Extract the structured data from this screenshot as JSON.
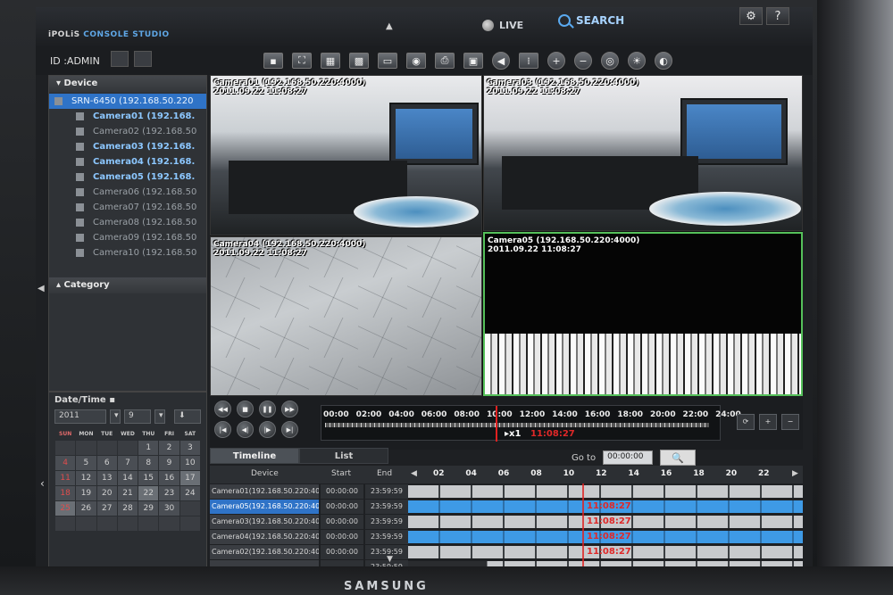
{
  "app": {
    "title_prefix": "iPOLiS",
    "title_accent": "CONSOLE STUDIO"
  },
  "topbar": {
    "live_label": "LIVE",
    "search_label": "SEARCH"
  },
  "user": {
    "id_label": "ID :ADMIN"
  },
  "device_panel": {
    "header": "Device",
    "items": [
      {
        "label": "SRN-6450 (192.168.50.220",
        "style": "selected"
      },
      {
        "label": "Camera01 (192.168.",
        "style": "bold"
      },
      {
        "label": "Camera02 (192.168.50",
        "style": "normal"
      },
      {
        "label": "Camera03 (192.168.",
        "style": "bold"
      },
      {
        "label": "Camera04 (192.168.",
        "style": "bold"
      },
      {
        "label": "Camera05 (192.168.",
        "style": "bold"
      },
      {
        "label": "Camera06 (192.168.50",
        "style": "normal"
      },
      {
        "label": "Camera07 (192.168.50",
        "style": "normal"
      },
      {
        "label": "Camera08 (192.168.50",
        "style": "normal"
      },
      {
        "label": "Camera09 (192.168.50",
        "style": "normal"
      },
      {
        "label": "Camera10 (192.168.50",
        "style": "normal"
      }
    ],
    "category_header": "Category"
  },
  "video": {
    "tiles": [
      {
        "title": "Camera01 (192.168.50.220:4000)",
        "date": "2011.09.22 11:08:27"
      },
      {
        "title": "Camera03 (192.168.50.220:4000)",
        "date": "2011.09.22 11:08:27"
      },
      {
        "title": "Camera04 (192.168.50.220:4000)",
        "date": "2011.09.22 11:08:27"
      },
      {
        "title": "Camera05 (192.168.50.220:4000)",
        "date": "2011.09.22 11:08:27"
      }
    ]
  },
  "datetime": {
    "title": "Date/Time",
    "year": "2011",
    "month": "9",
    "weekdays": [
      "SUN",
      "MON",
      "TUE",
      "WED",
      "THU",
      "FRI",
      "SAT"
    ],
    "days": [
      [
        "",
        "",
        "",
        "",
        "1",
        "2",
        "3"
      ],
      [
        "4",
        "5",
        "6",
        "7",
        "8",
        "9",
        "10"
      ],
      [
        "11",
        "12",
        "13",
        "14",
        "15",
        "16",
        "17"
      ],
      [
        "18",
        "19",
        "20",
        "21",
        "22",
        "23",
        "24"
      ],
      [
        "25",
        "26",
        "27",
        "28",
        "29",
        "30",
        ""
      ],
      [
        "",
        "",
        "",
        "",
        "",
        "",
        ""
      ]
    ]
  },
  "playback": {
    "ruler_labels": [
      "00:00",
      "02:00",
      "04:00",
      "06:00",
      "08:00",
      "10:00",
      "12:00",
      "14:00",
      "16:00",
      "18:00",
      "20:00",
      "22:00",
      "24:00"
    ],
    "speed": "▸x1",
    "time": "11:08:27"
  },
  "timeline": {
    "tabs": [
      "Timeline",
      "List"
    ],
    "goto_label": "Go to",
    "goto_value": "00:00:00",
    "columns": {
      "device": "Device",
      "start": "Start",
      "end": "End"
    },
    "hours": [
      "02",
      "04",
      "06",
      "08",
      "10",
      "12",
      "14",
      "16",
      "18",
      "20",
      "22"
    ],
    "rows": [
      {
        "device": "Camera01(192.168.50.220:40",
        "start": "00:00:00",
        "end": "23:59:59",
        "mark": ""
      },
      {
        "device": "Camera05(192.168.50.220:40",
        "start": "00:00:00",
        "end": "23:59:59",
        "mark": "11:08:27"
      },
      {
        "device": "Camera03(192.168.50.220:40",
        "start": "00:00:00",
        "end": "23:59:59",
        "mark": "11:08:27"
      },
      {
        "device": "Camera04(192.168.50.220:40",
        "start": "00:00:00",
        "end": "23:59:59",
        "mark": "11:08:27"
      },
      {
        "device": "Camera02(192.168.50.220:40",
        "start": "00:00:00",
        "end": "23:59:59",
        "mark": "11:08:27"
      },
      {
        "device": "",
        "start": "",
        "end": "23:59:59",
        "mark": ""
      }
    ]
  },
  "brand": "SAMSUNG"
}
